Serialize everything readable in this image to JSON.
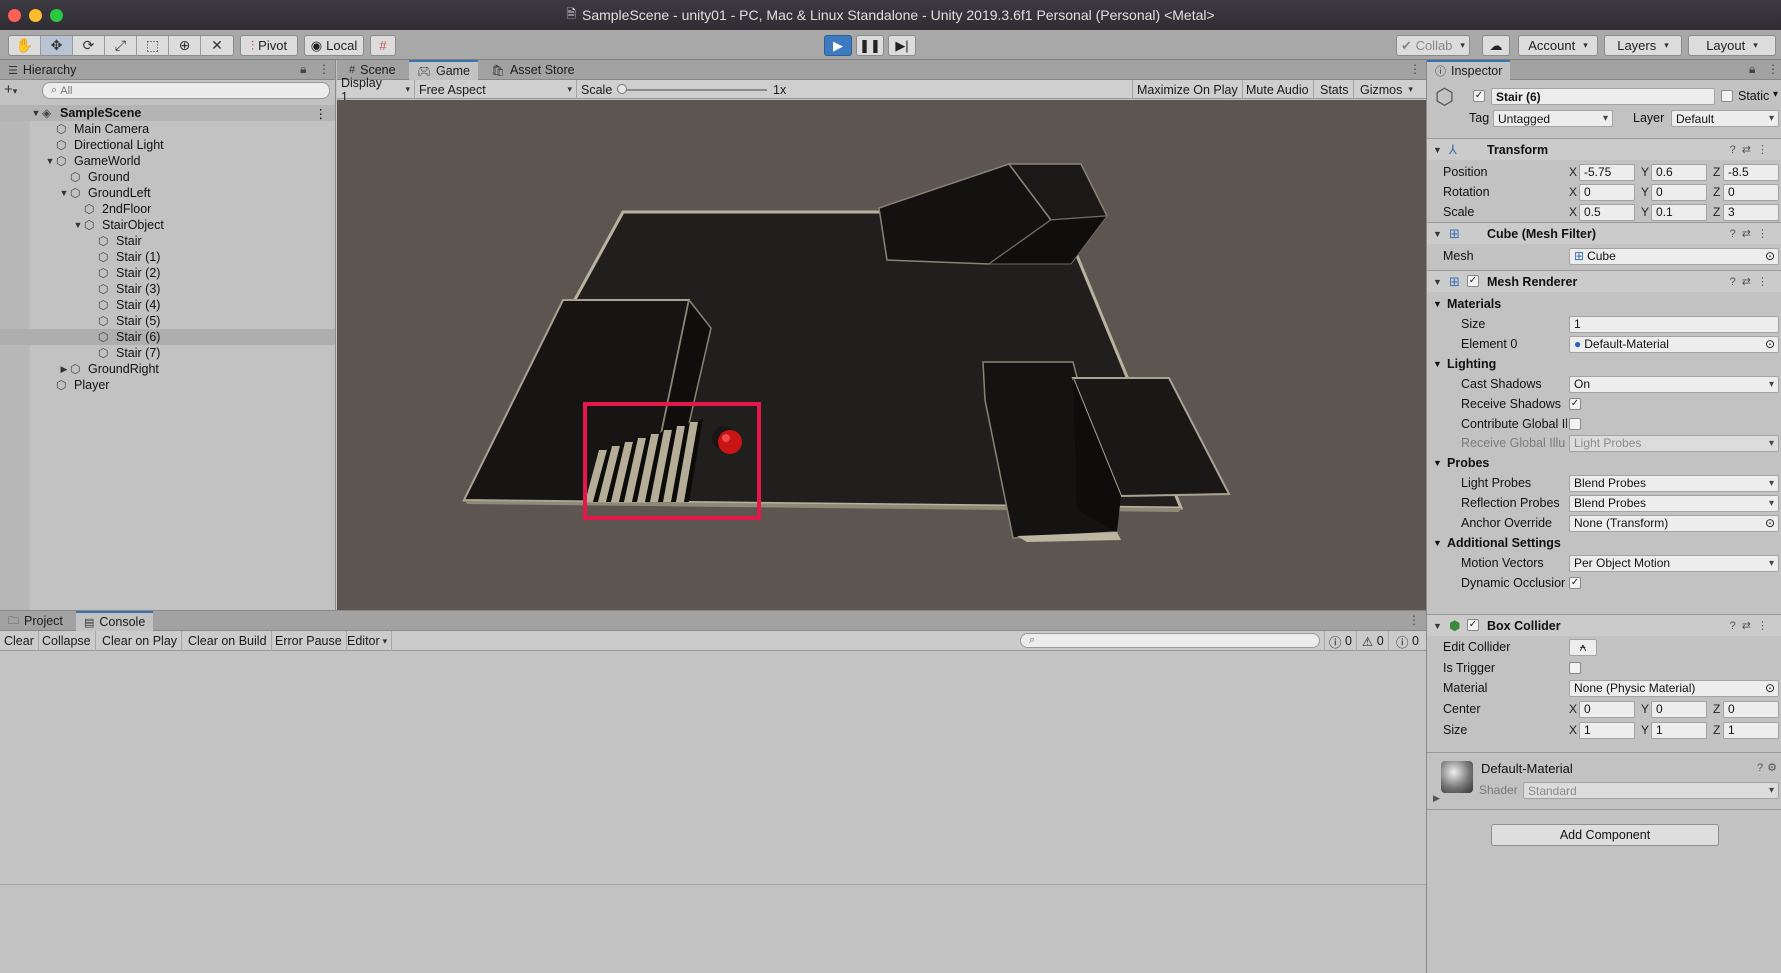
{
  "window": {
    "title": "SampleScene - unity01 - PC, Mac & Linux Standalone - Unity 2019.3.6f1 Personal (Personal) <Metal>"
  },
  "toolbar": {
    "pivot": "Pivot",
    "local": "Local",
    "collab": "Collab",
    "account": "Account",
    "layers": "Layers",
    "layout": "Layout"
  },
  "hierarchy": {
    "tab": "Hierarchy",
    "search_placeholder": "All",
    "items": [
      {
        "label": "SampleScene",
        "depth": 0,
        "arrow": "▼",
        "scene": true
      },
      {
        "label": "Main Camera",
        "depth": 1,
        "arrow": ""
      },
      {
        "label": "Directional Light",
        "depth": 1,
        "arrow": ""
      },
      {
        "label": "GameWorld",
        "depth": 1,
        "arrow": "▼"
      },
      {
        "label": "Ground",
        "depth": 2,
        "arrow": ""
      },
      {
        "label": "GroundLeft",
        "depth": 2,
        "arrow": "▼"
      },
      {
        "label": "2ndFloor",
        "depth": 3,
        "arrow": ""
      },
      {
        "label": "StairObject",
        "depth": 3,
        "arrow": "▼"
      },
      {
        "label": "Stair",
        "depth": 4,
        "arrow": ""
      },
      {
        "label": "Stair (1)",
        "depth": 4,
        "arrow": ""
      },
      {
        "label": "Stair (2)",
        "depth": 4,
        "arrow": ""
      },
      {
        "label": "Stair (3)",
        "depth": 4,
        "arrow": ""
      },
      {
        "label": "Stair (4)",
        "depth": 4,
        "arrow": ""
      },
      {
        "label": "Stair (5)",
        "depth": 4,
        "arrow": ""
      },
      {
        "label": "Stair (6)",
        "depth": 4,
        "arrow": "",
        "selected": true
      },
      {
        "label": "Stair (7)",
        "depth": 4,
        "arrow": ""
      },
      {
        "label": "GroundRight",
        "depth": 2,
        "arrow": "▶"
      },
      {
        "label": "Player",
        "depth": 1,
        "arrow": ""
      }
    ]
  },
  "view_tabs": {
    "scene": "Scene",
    "game": "Game",
    "asset_store": "Asset Store"
  },
  "game_toolbar": {
    "display": "Display 1",
    "aspect": "Free Aspect",
    "scale_label": "Scale",
    "scale_value": "1x",
    "maximize": "Maximize On Play",
    "mute": "Mute Audio",
    "stats": "Stats",
    "gizmos": "Gizmos"
  },
  "console": {
    "tab_project": "Project",
    "tab_console": "Console",
    "clear": "Clear",
    "collapse": "Collapse",
    "clear_on_play": "Clear on Play",
    "clear_on_build": "Clear on Build",
    "error_pause": "Error Pause",
    "editor": "Editor",
    "count_log": "0",
    "count_warn": "0",
    "count_error": "0"
  },
  "inspector": {
    "tab": "Inspector",
    "object_name": "Stair (6)",
    "static_label": "Static",
    "tag_label": "Tag",
    "tag_value": "Untagged",
    "layer_label": "Layer",
    "layer_value": "Default",
    "transform": {
      "title": "Transform",
      "position_label": "Position",
      "rotation_label": "Rotation",
      "scale_label": "Scale",
      "position": {
        "x": "-5.75",
        "y": "0.6",
        "z": "-8.5"
      },
      "rotation": {
        "x": "0",
        "y": "0",
        "z": "0"
      },
      "scale": {
        "x": "0.5",
        "y": "0.1",
        "z": "3"
      }
    },
    "mesh_filter": {
      "title": "Cube (Mesh Filter)",
      "mesh_label": "Mesh",
      "mesh_value": "Cube"
    },
    "mesh_renderer": {
      "title": "Mesh Renderer",
      "materials": "Materials",
      "size_label": "Size",
      "size_value": "1",
      "element0_label": "Element 0",
      "element0_value": "Default-Material",
      "lighting": "Lighting",
      "cast_shadows_label": "Cast Shadows",
      "cast_shadows_value": "On",
      "receive_shadows_label": "Receive Shadows",
      "contribute_gi_label": "Contribute Global Il",
      "receive_gi_label": "Receive Global Illu",
      "receive_gi_value": "Light Probes",
      "probes": "Probes",
      "light_probes_label": "Light Probes",
      "light_probes_value": "Blend Probes",
      "reflection_probes_label": "Reflection Probes",
      "reflection_probes_value": "Blend Probes",
      "anchor_override_label": "Anchor Override",
      "anchor_override_value": "None (Transform)",
      "additional": "Additional Settings",
      "motion_vectors_label": "Motion Vectors",
      "motion_vectors_value": "Per Object Motion",
      "dynamic_occlusion_label": "Dynamic Occlusior"
    },
    "box_collider": {
      "title": "Box Collider",
      "edit_collider_label": "Edit Collider",
      "is_trigger_label": "Is Trigger",
      "material_label": "Material",
      "material_value": "None (Physic Material)",
      "center_label": "Center",
      "size_label": "Size",
      "center": {
        "x": "0",
        "y": "0",
        "z": "0"
      },
      "size": {
        "x": "1",
        "y": "1",
        "z": "1"
      }
    },
    "material": {
      "name": "Default-Material",
      "shader_label": "Shader",
      "shader_value": "Standard"
    },
    "add_component": "Add Component"
  },
  "colors": {
    "highlight_box": "#e8174a",
    "play_active": "#3d7ac0",
    "ball": "#cc1010"
  }
}
